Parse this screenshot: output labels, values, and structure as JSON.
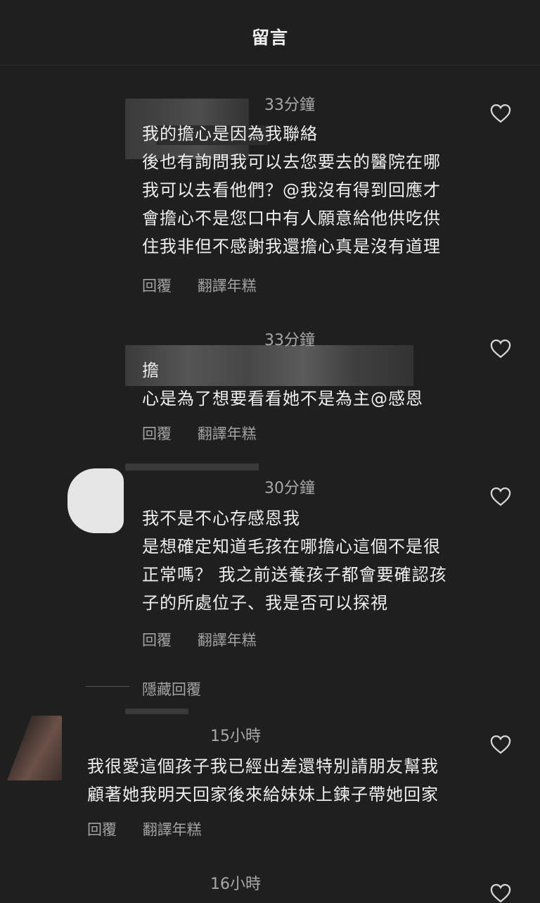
{
  "header": {
    "title": "留言"
  },
  "comments": [
    {
      "time": "33分鐘",
      "text": "我的擔心是因為我聯絡\n後也有詢問我可以去您要去的醫院在哪\n我可以去看他們？@我沒有得到回應才\n會擔心不是您口中有人願意給他供吃供\n住我非但不感謝我還擔心真是沒有道理",
      "reply": "回覆",
      "translate": "翻譯年糕"
    },
    {
      "time": "33分鐘",
      "text": "擔\n心是為了想要看看她不是為主@感恩",
      "reply": "回覆",
      "translate": "翻譯年糕"
    },
    {
      "time": "30分鐘",
      "text": "我不是不心存感恩我\n是想確定知道毛孩在哪擔心這個不是很\n正常嗎？ 我之前送養孩子都會要確認孩\n子的所處位子、我是否可以探視",
      "reply": "回覆",
      "translate": "翻譯年糕"
    },
    {
      "time": "15小時",
      "text": "我很愛這個孩子我已經出差還特別請朋友幫我\n顧著她我明天回家後來給妹妹上鍊子帶她回家",
      "reply": "回覆",
      "translate": "翻譯年糕"
    },
    {
      "time": "16小時"
    }
  ],
  "hidden_replies_label": "隱藏回覆",
  "icons": {
    "like": "heart-outline-icon"
  },
  "colors": {
    "background": "#1f1f1f",
    "text": "#efefef",
    "muted": "#a3a3a3"
  }
}
